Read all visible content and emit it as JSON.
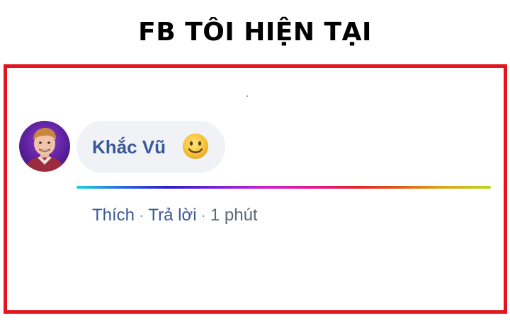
{
  "headline": "FB TÔI HIỆN TẠI",
  "comment": {
    "author_name": "Khắc Vũ",
    "emoji_icon": "slightly-smiling-face-icon",
    "like_label": "Thích",
    "reply_label": "Trả lời",
    "separator": "·",
    "time_label": "1 phút"
  },
  "colors": {
    "frame_border": "#e3161f",
    "author_link": "#385898",
    "bubble_bg": "#f0f2f5"
  }
}
